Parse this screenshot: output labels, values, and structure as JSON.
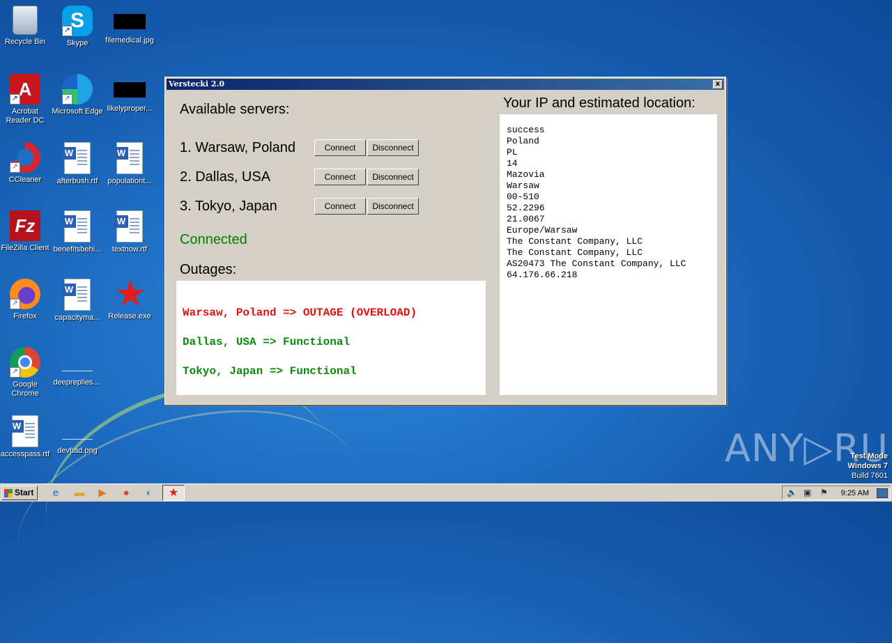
{
  "desktop": {
    "icons": [
      {
        "label": "Recycle Bin"
      },
      {
        "label": "Skype"
      },
      {
        "label": "filemedical.jpg"
      },
      {
        "label": "Acrobat Reader DC"
      },
      {
        "label": "Microsoft Edge"
      },
      {
        "label": "likelyproper..."
      },
      {
        "label": "CCleaner"
      },
      {
        "label": "afterbush.rtf"
      },
      {
        "label": "populationt..."
      },
      {
        "label": "FileZilla Client"
      },
      {
        "label": "benefitsbehi..."
      },
      {
        "label": "textnow.rtf"
      },
      {
        "label": "Firefox"
      },
      {
        "label": "capacityma..."
      },
      {
        "label": "Release.exe"
      },
      {
        "label": "Google Chrome"
      },
      {
        "label": "deepreplies...."
      },
      {
        "label": "accesspass.rtf"
      },
      {
        "label": "devbad.png"
      }
    ]
  },
  "window": {
    "title": "Verstecki 2.0",
    "close_glyph": "x",
    "available_heading": "Available servers:",
    "servers": [
      {
        "label": "1. Warsaw, Poland",
        "connect": "Connect",
        "disconnect": "Disconnect"
      },
      {
        "label": "2. Dallas, USA",
        "connect": "Connect",
        "disconnect": "Disconnect"
      },
      {
        "label": "3. Tokyo, Japan",
        "connect": "Connect",
        "disconnect": "Disconnect"
      }
    ],
    "status": "Connected",
    "status_color": "#008000",
    "outages_heading": "Outages:",
    "outages": [
      {
        "text": "Warsaw, Poland => OUTAGE (OVERLOAD)",
        "color": "#e01010"
      },
      {
        "text": "Dallas, USA => Functional",
        "color": "#0a8a0a"
      },
      {
        "text": "Tokyo, Japan => Functional",
        "color": "#0a8a0a"
      }
    ],
    "ip_heading": "Your IP and estimated location:",
    "ip_lines": [
      "success",
      "Poland",
      "PL",
      "14",
      "Mazovia",
      "Warsaw",
      "00-510",
      "52.2296",
      "21.0067",
      "Europe/Warsaw",
      "The Constant Company, LLC",
      "The Constant Company, LLC",
      "AS20473 The Constant Company, LLC",
      "64.176.66.218"
    ]
  },
  "watermark": "ANY▷RUN",
  "test_mode": {
    "line1": "Test Mode",
    "line2": "Windows 7",
    "line3": "Build 7601"
  },
  "taskbar": {
    "start_label": "Start",
    "pinned_icons": [
      "ie-icon",
      "explorer-icon",
      "media-player-icon",
      "chrome-icon",
      "edge-icon"
    ],
    "active_app_icon": "red-star-icon",
    "clock": "9:25 AM"
  }
}
